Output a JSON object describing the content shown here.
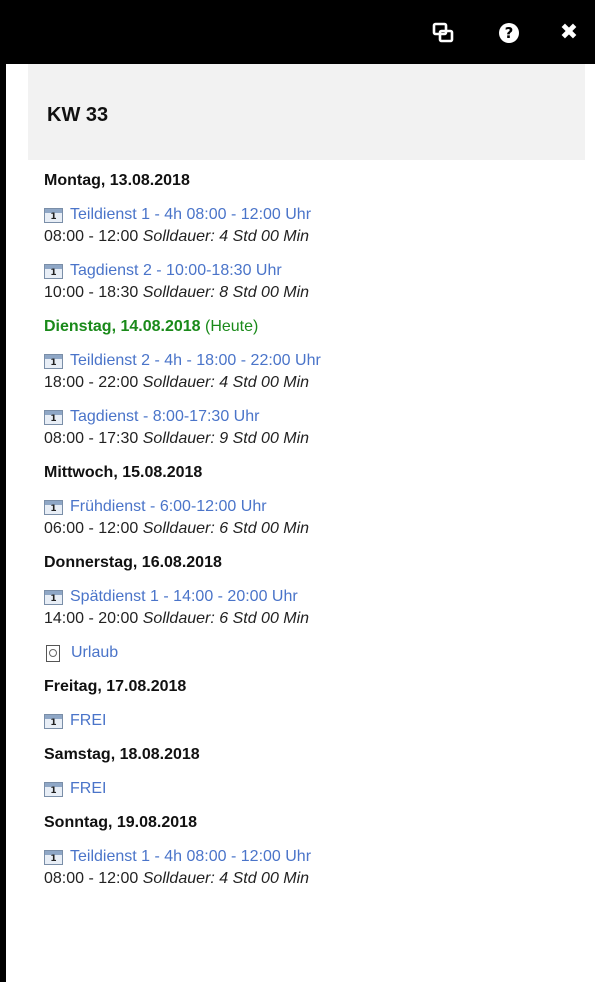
{
  "toolbar": {
    "restore_icon": "restore-window-icon",
    "help_icon": "help-icon",
    "close_icon": "close-icon",
    "help_glyph": "?",
    "close_glyph": "✖"
  },
  "week": {
    "title": "KW 33"
  },
  "days": [
    {
      "label": "Montag, 13.08.2018",
      "today": false,
      "entries": [
        {
          "title": "Teildienst 1 - 4h 08:00 - 12:00 Uhr",
          "time": "08:00 - 12:00",
          "duration": "Solldauer: 4 Std 00 Min"
        },
        {
          "title": "Tagdienst 2 - 10:00-18:30 Uhr",
          "time": "10:00 - 18:30",
          "duration": "Solldauer: 8 Std 00 Min"
        }
      ]
    },
    {
      "label": "Dienstag, 14.08.2018",
      "today": true,
      "today_note": "(Heute)",
      "entries": [
        {
          "title": "Teildienst 2 - 4h - 18:00 - 22:00 Uhr",
          "time": "18:00 - 22:00",
          "duration": "Solldauer: 4 Std 00 Min"
        },
        {
          "title": "Tagdienst - 8:00-17:30 Uhr",
          "time": "08:00 - 17:30",
          "duration": "Solldauer: 9 Std 00 Min"
        }
      ]
    },
    {
      "label": "Mittwoch, 15.08.2018",
      "today": false,
      "entries": [
        {
          "title": "Frühdienst - 6:00-12:00 Uhr",
          "time": "06:00 - 12:00",
          "duration": "Solldauer: 6 Std 00 Min"
        }
      ]
    },
    {
      "label": "Donnerstag, 16.08.2018",
      "today": false,
      "entries": [
        {
          "title": "Spätdienst 1 - 14:00 - 20:00 Uhr",
          "time": "14:00 - 20:00",
          "duration": "Solldauer: 6 Std 00 Min"
        },
        {
          "title": "Urlaub",
          "icon": "document-icon"
        }
      ]
    },
    {
      "label": "Freitag, 17.08.2018",
      "today": false,
      "entries": [
        {
          "title": "FREI"
        }
      ]
    },
    {
      "label": "Samstag, 18.08.2018",
      "today": false,
      "entries": [
        {
          "title": "FREI"
        }
      ]
    },
    {
      "label": "Sonntag, 19.08.2018",
      "today": false,
      "entries": [
        {
          "title": "Teildienst 1 - 4h 08:00 - 12:00 Uhr",
          "time": "08:00 - 12:00",
          "duration": "Solldauer: 4 Std 00 Min"
        }
      ]
    }
  ],
  "colors": {
    "link": "#4a74c9",
    "today": "#1a8a1a",
    "toolbar_bg": "#000000",
    "header_bg": "#f2f2f2"
  }
}
